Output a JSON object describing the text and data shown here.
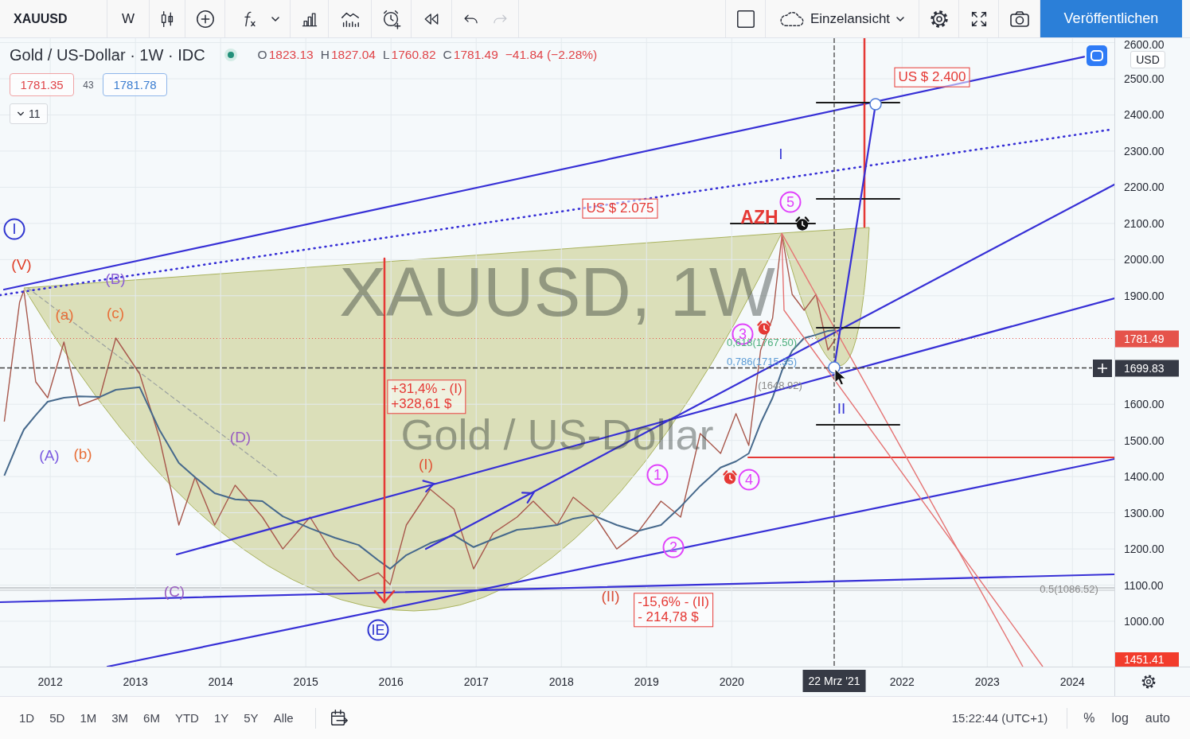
{
  "toolbar": {
    "symbol": "XAUUSD",
    "interval": "W",
    "undo": {
      "disabled": false
    },
    "redo": {
      "disabled": true
    },
    "layout": "Einzelansicht",
    "publish": "Veröffentlichen"
  },
  "legend": {
    "title": "Gold / US-Dollar · 1W · IDC",
    "market_open": true,
    "ohlc": [
      {
        "label": "O",
        "value": "1823.13"
      },
      {
        "label": "H",
        "value": "1827.04"
      },
      {
        "label": "L",
        "value": "1760.82"
      },
      {
        "label": "C",
        "value": "1781.49"
      }
    ],
    "change": "−41.84 (−2.28%)",
    "sell": "1781.35",
    "spread": "43",
    "buy": "1781.78",
    "indicators": {
      "count": "11",
      "expanded": false
    }
  },
  "chart": {
    "watermark": {
      "symbol": "XAUUSD, 1W",
      "description": "Gold / US-Dollar"
    },
    "currency": "USD",
    "chart_data": {
      "type": "line",
      "x": [
        2011.46,
        2011.64,
        2011.69,
        2011.83,
        2011.97,
        2012.16,
        2012.34,
        2012.58,
        2012.77,
        2013.05,
        2013.28,
        2013.51,
        2013.7,
        2013.93,
        2014.17,
        2014.49,
        2014.73,
        2015.05,
        2015.34,
        2015.62,
        2015.85,
        2015.99,
        2016.18,
        2016.46,
        2016.74,
        2016.97,
        2017.2,
        2017.48,
        2017.67,
        2017.95,
        2018.14,
        2018.37,
        2018.65,
        2018.89,
        2019.17,
        2019.4,
        2019.63,
        2019.87,
        2020.05,
        2020.2,
        2020.34,
        2020.48,
        2020.59,
        2020.71,
        2020.85,
        2020.99,
        2021.13,
        2021.22
      ],
      "series": [
        {
          "color": "#a8584c",
          "values": [
            1552,
            1882,
            1915,
            1662,
            1618,
            1772,
            1596,
            1618,
            1783,
            1684,
            1508,
            1266,
            1398,
            1266,
            1376,
            1288,
            1200,
            1288,
            1178,
            1112,
            1134,
            1101,
            1266,
            1365,
            1310,
            1145,
            1244,
            1288,
            1332,
            1266,
            1343,
            1299,
            1200,
            1244,
            1332,
            1288,
            1519,
            1464,
            1574,
            1486,
            1750,
            1838,
            2069,
            1904,
            1860,
            1904,
            1750,
            1781
          ]
        },
        {
          "color": "#46698c",
          "values": [
            1403,
            1504,
            1530,
            1570,
            1607,
            1618,
            1622,
            1620,
            1640,
            1647,
            1530,
            1438,
            1398,
            1354,
            1337,
            1332,
            1290,
            1257,
            1231,
            1211,
            1169,
            1145,
            1183,
            1216,
            1238,
            1205,
            1227,
            1253,
            1257,
            1266,
            1284,
            1293,
            1266,
            1249,
            1266,
            1317,
            1374,
            1425,
            1442,
            1464,
            1548,
            1618,
            1693,
            1748,
            1783,
            1792,
            1803,
            1805
          ]
        }
      ],
      "xlim": [
        2011.41,
        2025.38
      ],
      "ylim": [
        874.6,
        2612.2
      ],
      "grid": true,
      "xticks": [
        {
          "value": 2012,
          "label": "2012"
        },
        {
          "value": 2013,
          "label": "2013"
        },
        {
          "value": 2014,
          "label": "2014"
        },
        {
          "value": 2015,
          "label": "2015"
        },
        {
          "value": 2016,
          "label": "2016"
        },
        {
          "value": 2017,
          "label": "2017"
        },
        {
          "value": 2018,
          "label": "2018"
        },
        {
          "value": 2019,
          "label": "2019"
        },
        {
          "value": 2020,
          "label": "2020"
        },
        {
          "value": 2022,
          "label": "2022"
        },
        {
          "value": 2023,
          "label": "2023"
        },
        {
          "value": 2024,
          "label": "2024"
        }
      ],
      "yticks": [
        {
          "value": 2600,
          "label": "2600.00"
        },
        {
          "value": 2500,
          "label": "2500.00"
        },
        {
          "value": 2400,
          "label": "2400.00"
        },
        {
          "value": 2300,
          "label": "2300.00"
        },
        {
          "value": 2200,
          "label": "2200.00"
        },
        {
          "value": 2100,
          "label": "2100.00"
        },
        {
          "value": 2000,
          "label": "2000.00"
        },
        {
          "value": 1900,
          "label": "1900.00"
        },
        {
          "value": 1600,
          "label": "1600.00"
        },
        {
          "value": 1500,
          "label": "1500.00"
        },
        {
          "value": 1400,
          "label": "1400.00"
        },
        {
          "value": 1300,
          "label": "1300.00"
        },
        {
          "value": 1200,
          "label": "1200.00"
        },
        {
          "value": 1100,
          "label": "1100.00"
        },
        {
          "value": 1000,
          "label": "1000.00"
        }
      ]
    },
    "drawings": [
      {
        "kind": "circled",
        "text": "I",
        "color": "#2f35d0"
      },
      {
        "kind": "label",
        "text": "(V)",
        "color": "#e0402a"
      },
      {
        "kind": "label",
        "text": "(B)",
        "color": "#8b5fd6"
      },
      {
        "kind": "label",
        "text": "(a)",
        "color": "#e8703a"
      },
      {
        "kind": "label",
        "text": "(c)",
        "color": "#e8703a"
      },
      {
        "kind": "label",
        "text": "(A)",
        "color": "#7b5be0"
      },
      {
        "kind": "label",
        "text": "(b)",
        "color": "#e8703a"
      },
      {
        "kind": "label",
        "text": "(D)",
        "color": "#9a60c0"
      },
      {
        "kind": "label",
        "text": "(C)",
        "color": "#9a60c0"
      },
      {
        "kind": "circled",
        "text": "IE",
        "color": "#2f35d0"
      },
      {
        "kind": "box",
        "lines": [
          "+31,4% - (I)",
          "+328,61 $"
        ],
        "color": "#e53935"
      },
      {
        "kind": "label",
        "text": "(I)",
        "color": "#e0583a"
      },
      {
        "kind": "box",
        "lines": [
          "US $ 2.075"
        ],
        "color": "#e53935"
      },
      {
        "kind": "box",
        "lines": [
          "US $ 2.400"
        ],
        "color": "#e53935"
      },
      {
        "kind": "big_label",
        "text": "AZH",
        "color": "#e53935"
      },
      {
        "kind": "circled",
        "text": "5",
        "color": "#e040fb"
      },
      {
        "kind": "alarm",
        "color": "#111111"
      },
      {
        "kind": "label",
        "text": "I",
        "color": "#3b3bd6"
      },
      {
        "kind": "label",
        "text": "II",
        "color": "#3b3bd6"
      },
      {
        "kind": "circled",
        "text": "3",
        "color": "#e040fb"
      },
      {
        "kind": "alarm",
        "color": "#e53935"
      },
      {
        "kind": "fib",
        "text": "0,618(1767.50)",
        "color": "#4caf7d"
      },
      {
        "kind": "fib",
        "text": "0,786(1715.35)",
        "color": "#5b9bd5"
      },
      {
        "kind": "fib",
        "text": "(1648.92)",
        "color": "#8a8a8a"
      },
      {
        "kind": "circled",
        "text": "1",
        "color": "#e040fb"
      },
      {
        "kind": "circled",
        "text": "2",
        "color": "#e040fb"
      },
      {
        "kind": "circled",
        "text": "4",
        "color": "#e040fb"
      },
      {
        "kind": "alarm",
        "color": "#e53935"
      },
      {
        "kind": "label",
        "text": "(II)",
        "color": "#d9503a"
      },
      {
        "kind": "box",
        "lines": [
          "-15,6% - (II)",
          "- 214,78 $"
        ],
        "color": "#e53935"
      },
      {
        "kind": "fib",
        "text": "0.5(1086.52)",
        "color": "#8a8a8a"
      }
    ],
    "price_tags": [
      {
        "kind": "last_price",
        "text": "1781.49",
        "color": "#e5534b"
      },
      {
        "kind": "crosshair",
        "text": "1699.83",
        "color": "#363a45"
      },
      {
        "kind": "pinned_bottom",
        "text": "1451.41",
        "color": "#f23c2c"
      }
    ],
    "time_tag": {
      "text": "22 Mrz '21",
      "color": "#363a45"
    }
  },
  "bottom_bar": {
    "ranges": [
      {
        "label": "1D",
        "selected": false
      },
      {
        "label": "5D",
        "selected": false
      },
      {
        "label": "1M",
        "selected": false
      },
      {
        "label": "3M",
        "selected": false
      },
      {
        "label": "6M",
        "selected": false
      },
      {
        "label": "YTD",
        "selected": false
      },
      {
        "label": "1Y",
        "selected": false
      },
      {
        "label": "5Y",
        "selected": false
      },
      {
        "label": "Alle",
        "selected": false
      }
    ],
    "clock": "15:22:44 (UTC+1)",
    "toggles": [
      {
        "label": "%",
        "on": false
      },
      {
        "label": "log",
        "on": false
      },
      {
        "label": "auto",
        "on": false
      }
    ]
  }
}
